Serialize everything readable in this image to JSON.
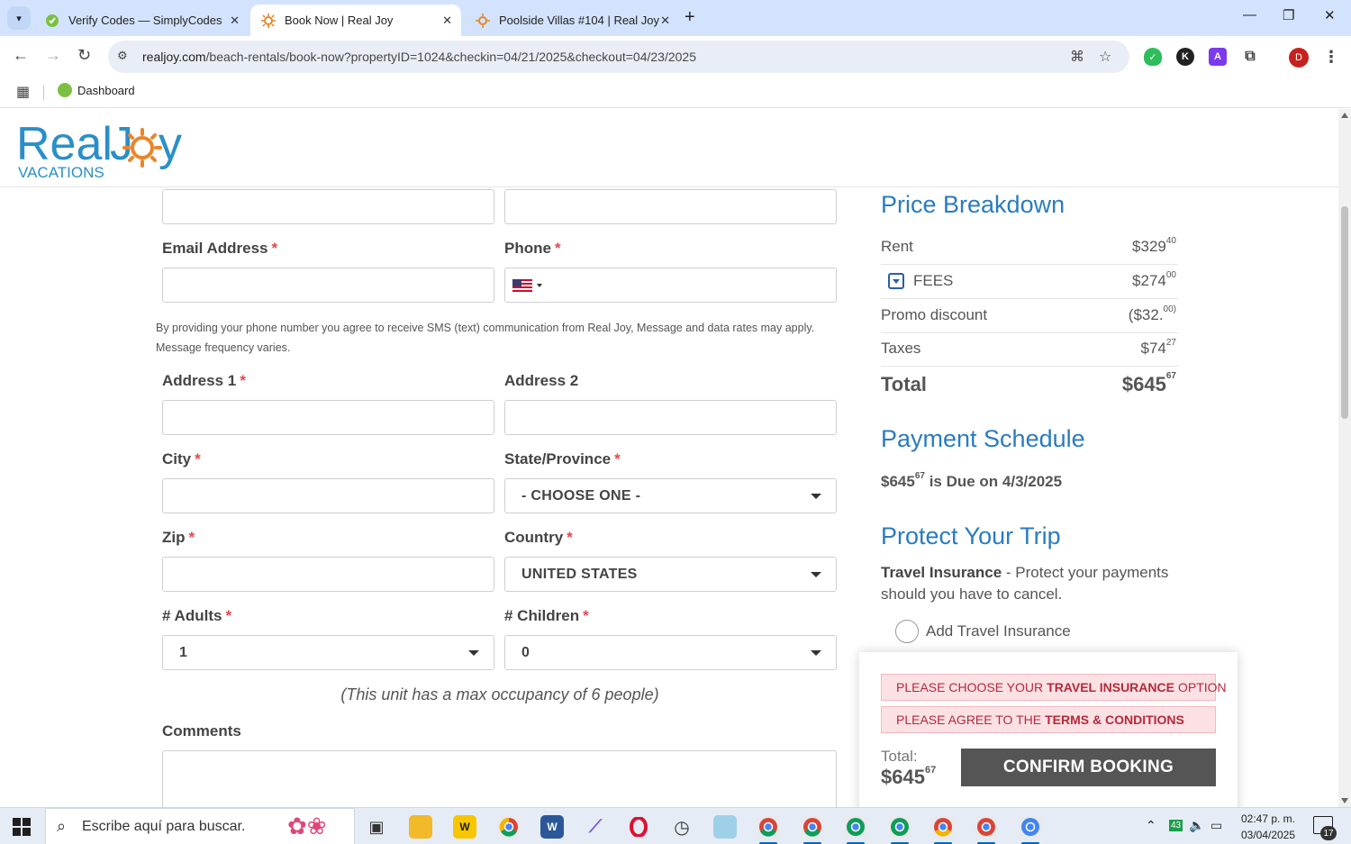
{
  "browser": {
    "tabs": [
      {
        "label": "Verify Codes — SimplyCodes",
        "active": false
      },
      {
        "label": "Book Now | Real Joy",
        "active": true
      },
      {
        "label": "Poolside Villas #104 | Real Joy",
        "active": false
      }
    ],
    "url_host": "realjoy.com",
    "url_path": "/beach-rentals/book-now?propertyID=1024&checkin=04/21/2025&checkout=04/23/2025",
    "bookmark": "Dashboard",
    "profile_initial": "D"
  },
  "logo": {
    "brand": "RealJoy",
    "tagline": "VACATIONS"
  },
  "form": {
    "email_label": "Email Address",
    "phone_label": "Phone",
    "required_mark": "*",
    "sms_note": "By providing your phone number you agree to receive SMS (text) communication from Real Joy, Message and data rates may apply. Message frequency varies.",
    "address1_label": "Address 1",
    "address2_label": "Address 2",
    "city_label": "City",
    "state_label": "State/Province",
    "state_value": "- CHOOSE ONE -",
    "zip_label": "Zip",
    "country_label": "Country",
    "country_value": "UNITED STATES",
    "adults_label": "# Adults",
    "adults_value": "1",
    "children_label": "# Children",
    "children_value": "0",
    "occupancy_note": "(This unit has a max occupancy of 6 people)",
    "comments_label": "Comments"
  },
  "price_breakdown": {
    "title": "Price Breakdown",
    "rows": [
      {
        "label": "Rent",
        "amount": "$329",
        "cents": "40"
      },
      {
        "label": "FEES",
        "amount": "$274",
        "cents": "00"
      },
      {
        "label": "Promo discount",
        "amount": "($32.",
        "cents": "00)"
      },
      {
        "label": "Taxes",
        "amount": "$74",
        "cents": "27"
      }
    ],
    "total_label": "Total",
    "total_amount": "$645",
    "total_cents": "67"
  },
  "payment_schedule": {
    "title": "Payment Schedule",
    "amount": "$645",
    "cents": "67",
    "due_text": "is Due on 4/3/2025"
  },
  "protect": {
    "title": "Protect Your Trip",
    "insurance_bold": "Travel Insurance",
    "insurance_text": " - Protect your payments should you have to cancel.",
    "radio_label": "Add Travel Insurance"
  },
  "booking": {
    "alert1_pre": "PLEASE CHOOSE YOUR",
    "alert1_bold": "TRAVEL INSURANCE",
    "alert1_post": "OPTION",
    "alert2_pre": "PLEASE AGREE TO THE",
    "alert2_bold": "TERMS & CONDITIONS",
    "total_label": "Total:",
    "total_amount": "$645",
    "total_cents": "67",
    "confirm_label": "CONFIRM BOOKING"
  },
  "taskbar": {
    "search_placeholder": "Escribe aquí para buscar.",
    "time": "02:47 p. m.",
    "date": "03/04/2025",
    "notifications": "17",
    "tray_badge": "43"
  },
  "colors": {
    "accent_blue": "#2a7cbf",
    "required_red": "#e4474d",
    "alert_bg": "#fbe1e4",
    "button_gray": "#555555"
  }
}
